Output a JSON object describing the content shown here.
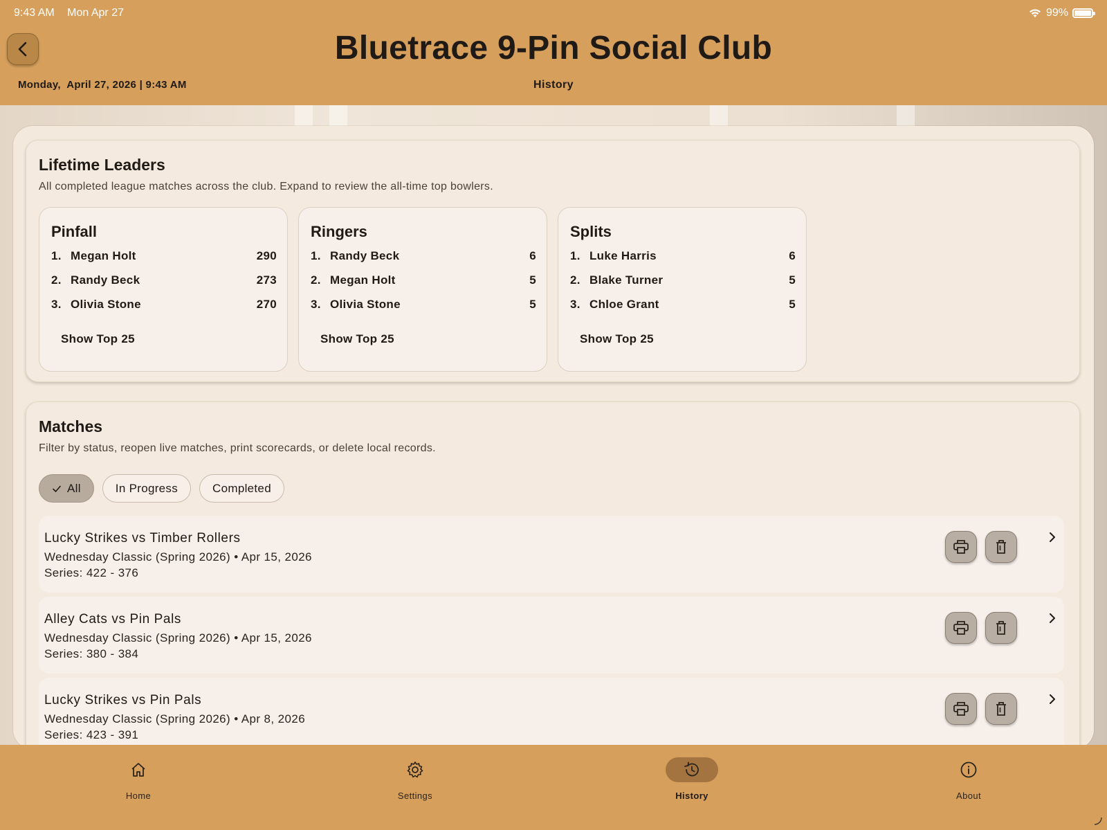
{
  "status_bar": {
    "time": "9:43 AM",
    "date": "Mon Apr 27",
    "battery": "99%",
    "battery_level": 0.99
  },
  "header": {
    "title": "Bluetrace 9-Pin Social Club",
    "datetime": "Monday,  April 27, 2026 | 9:43 AM",
    "section": "History",
    "back_icon": "chevron-left-icon"
  },
  "leaders": {
    "title": "Lifetime Leaders",
    "subtitle": "All completed league matches across the club. Expand to review the all-time top bowlers.",
    "boxes": [
      {
        "title": "Pinfall",
        "rows": [
          {
            "rank": "1.",
            "name": "Megan Holt",
            "value": "290"
          },
          {
            "rank": "2.",
            "name": "Randy Beck",
            "value": "273"
          },
          {
            "rank": "3.",
            "name": "Olivia Stone",
            "value": "270"
          }
        ],
        "show_label": "Show Top 25"
      },
      {
        "title": "Ringers",
        "rows": [
          {
            "rank": "1.",
            "name": "Randy Beck",
            "value": "6"
          },
          {
            "rank": "2.",
            "name": "Megan Holt",
            "value": "5"
          },
          {
            "rank": "3.",
            "name": "Olivia Stone",
            "value": "5"
          }
        ],
        "show_label": "Show Top 25"
      },
      {
        "title": "Splits",
        "rows": [
          {
            "rank": "1.",
            "name": "Luke Harris",
            "value": "6"
          },
          {
            "rank": "2.",
            "name": "Blake Turner",
            "value": "5"
          },
          {
            "rank": "3.",
            "name": "Chloe Grant",
            "value": "5"
          }
        ],
        "show_label": "Show Top 25"
      }
    ]
  },
  "matches": {
    "title": "Matches",
    "subtitle": "Filter by status, reopen live matches, print scorecards, or delete local records.",
    "filters": [
      {
        "label": "All",
        "selected": true
      },
      {
        "label": "In Progress",
        "selected": false
      },
      {
        "label": "Completed",
        "selected": false
      }
    ],
    "items": [
      {
        "title": "Lucky Strikes vs Timber Rollers",
        "meta": "Wednesday Classic (Spring 2026) • Apr 15, 2026",
        "series": "Series: 422 - 376"
      },
      {
        "title": "Alley Cats vs Pin Pals",
        "meta": "Wednesday Classic (Spring 2026) • Apr 15, 2026",
        "series": "Series: 380 - 384"
      },
      {
        "title": "Lucky Strikes vs Pin Pals",
        "meta": "Wednesday Classic (Spring 2026) • Apr 8, 2026",
        "series": "Series: 423 - 391"
      }
    ],
    "row_icons": [
      "print-icon",
      "trash-icon",
      "chevron-right-icon"
    ]
  },
  "bottom_nav": [
    {
      "label": "Home",
      "icon": "home-icon",
      "active": false
    },
    {
      "label": "Settings",
      "icon": "gear-icon",
      "active": false
    },
    {
      "label": "History",
      "icon": "history-icon",
      "active": true
    },
    {
      "label": "About",
      "icon": "info-icon",
      "active": false
    }
  ],
  "colors": {
    "accent": "#d69f5c",
    "active_nav": "#a37440",
    "panel": "#f3e9dc",
    "text": "#1f1a15"
  }
}
